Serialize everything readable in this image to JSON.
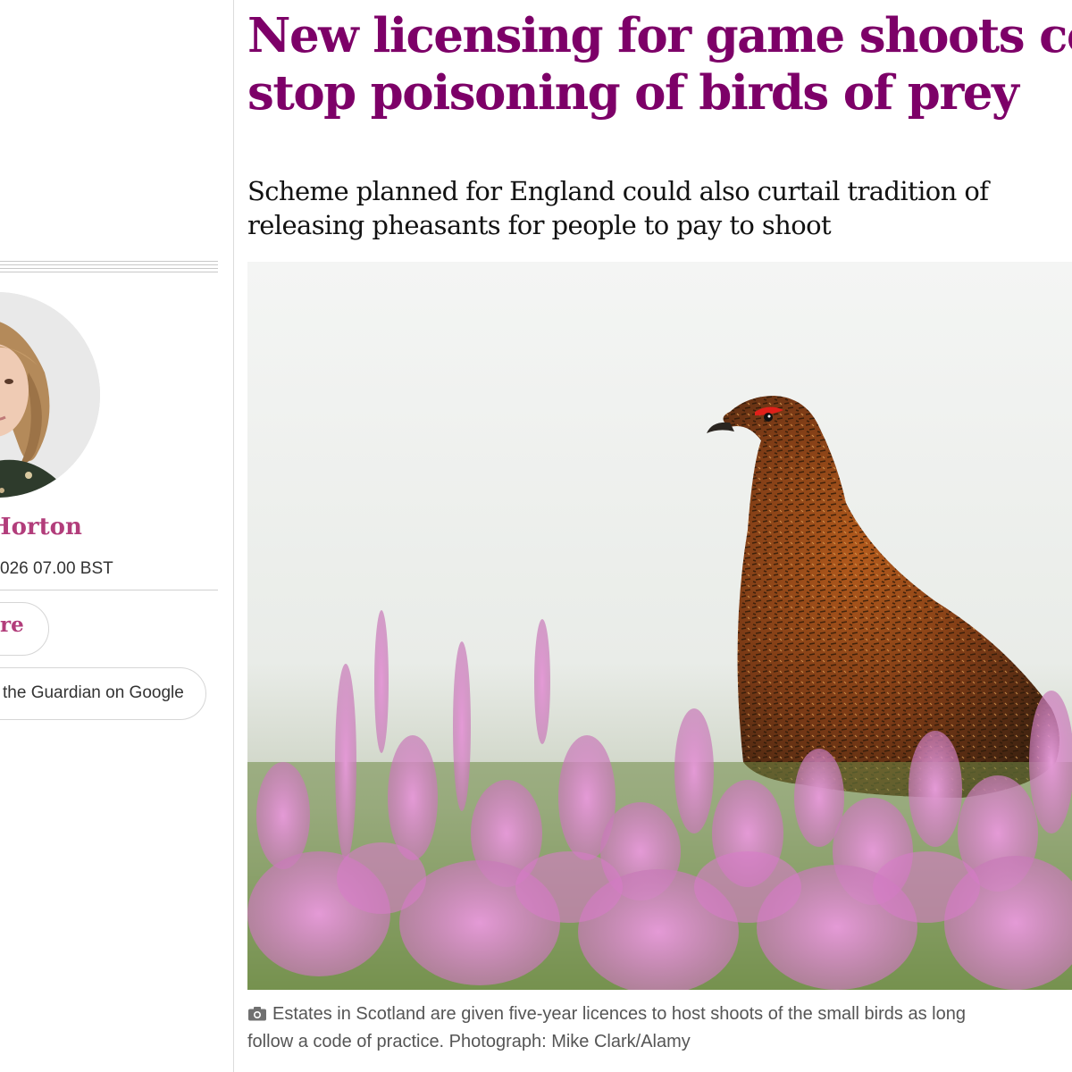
{
  "article": {
    "headline_line1": "New licensing for game shoots could",
    "headline_line2": "stop poisoning of birds of prey",
    "standfirst_line1": "Scheme planned for England could also curtail tradition of",
    "standfirst_line2": "releasing pheasants for people to pay to shoot"
  },
  "meta": {
    "byline": "Horton",
    "dateline": "026 07.00 BST",
    "share_label": "re",
    "google_label": "the Guardian on Google"
  },
  "image": {
    "caption_line1": "Estates in Scotland are given five-year licences to host shoots of the small birds as long",
    "caption_line2": "follow a code of practice. Photograph: Mike Clark/Alamy",
    "icon": "camera-icon"
  },
  "colors": {
    "headline": "#7d0068",
    "byline": "#b23d7b",
    "text": "#121212",
    "caption": "#555555"
  }
}
